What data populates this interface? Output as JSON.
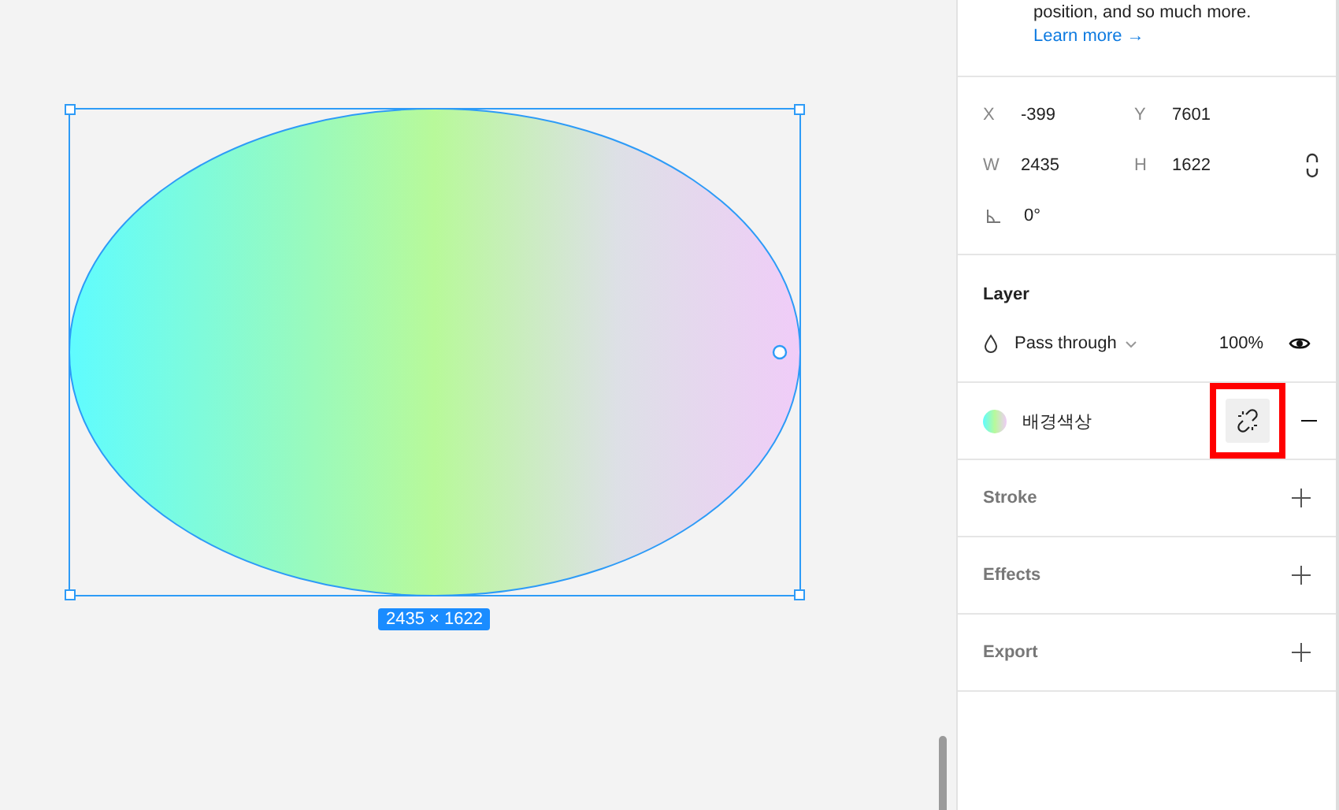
{
  "canvas": {
    "selection_size": "2435 × 1622"
  },
  "panel": {
    "intro": {
      "text": "position, and so much more.",
      "link": "Learn more →"
    },
    "fields": [
      {
        "label": "X",
        "value": "-399"
      },
      {
        "label": "Y",
        "value": "7601"
      },
      {
        "label": "W",
        "value": "2435"
      },
      {
        "label": "H",
        "value": "1622"
      }
    ],
    "rotation": "0°",
    "layer": {
      "title": "Layer",
      "blend_mode": "Pass through",
      "opacity": "100%"
    },
    "fill": {
      "name": "배경색상"
    },
    "sections": [
      {
        "title": "Stroke"
      },
      {
        "title": "Effects"
      },
      {
        "title": "Export"
      }
    ]
  }
}
